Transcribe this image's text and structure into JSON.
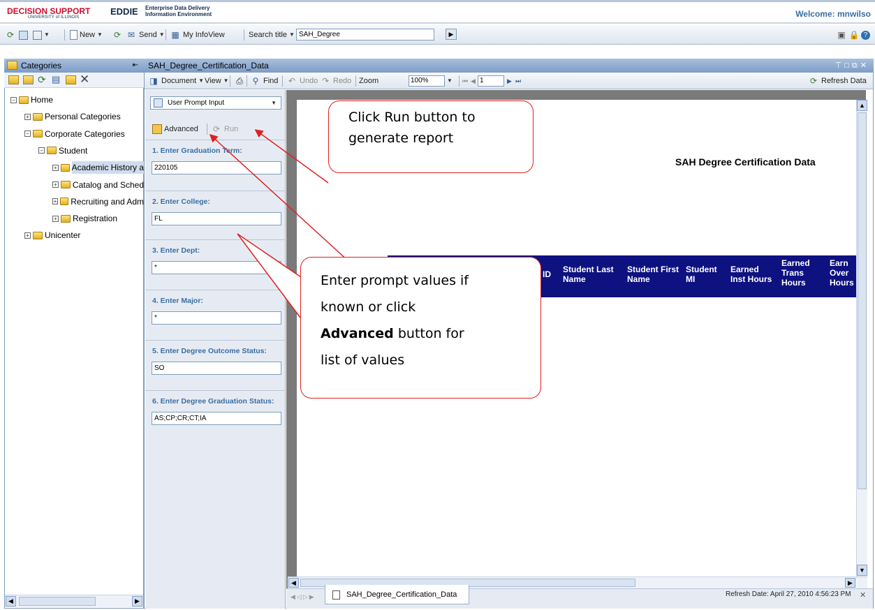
{
  "header": {
    "logo_ds": "DECISION SUPPORT",
    "logo_ds_sub": "UNIVERSITY of ILLINOIS",
    "logo_eddie": "EDDIE",
    "logo_eddie_line1": "Enterprise Data Delivery",
    "logo_eddie_line2": "Information Environment",
    "welcome": "Welcome: mnwilso"
  },
  "toolbar": {
    "new_label": "New",
    "send_label": "Send",
    "myinfoview_label": "My InfoView",
    "search_title_label": "Search title",
    "search_value": "SAH_Degree"
  },
  "left_panel": {
    "title": "Categories",
    "tree": [
      {
        "label": "Home",
        "level": 0,
        "expander": "−"
      },
      {
        "label": "Personal Categories",
        "level": 1,
        "expander": "+"
      },
      {
        "label": "Corporate Categories",
        "level": 1,
        "expander": "−"
      },
      {
        "label": "Student",
        "level": 2,
        "expander": "−"
      },
      {
        "label": "Academic History a",
        "level": 3,
        "expander": "+"
      },
      {
        "label": "Catalog and Sched",
        "level": 3,
        "expander": "+"
      },
      {
        "label": "Recruiting and Adm",
        "level": 3,
        "expander": "+"
      },
      {
        "label": "Registration",
        "level": 3,
        "expander": "+"
      },
      {
        "label": "Unicenter",
        "level": 1,
        "expander": "+"
      }
    ]
  },
  "document": {
    "title": "SAH_Degree_Certification_Data",
    "toolbar": {
      "document_label": "Document",
      "view_label": "View",
      "find_label": "Find",
      "undo_label": "Undo",
      "redo_label": "Redo",
      "zoom_label": "Zoom",
      "zoom_value": "100%",
      "page_value": "1",
      "refresh_label": "Refresh Data"
    }
  },
  "prompts": {
    "mode": "User Prompt Input",
    "advanced_label": "Advanced",
    "run_label": "Run",
    "items": [
      {
        "label": "1. Enter Graduation Term:",
        "value": "220105"
      },
      {
        "label": "2. Enter College:",
        "value": "FL"
      },
      {
        "label": "3. Enter Dept:",
        "value": "*"
      },
      {
        "label": "4. Enter Major:",
        "value": "*"
      },
      {
        "label": "5. Enter Degree Outcome Status:",
        "value": "SO"
      },
      {
        "label": "6. Enter Degree Graduation Status:",
        "value": "AS;CP;CR;CT;IA"
      }
    ]
  },
  "report": {
    "title": "SAH Degree Certification Data",
    "columns": [
      "ID",
      "Student Last Name",
      "Student First Name",
      "Student MI",
      "Earned Inst Hours",
      "Earned Trans Hours",
      "Earned Overall Hours"
    ],
    "column_fragments": {
      "id": "ID",
      "earned": "Earned",
      "earned_cut": "Earn",
      "trans": "Trans",
      "hours": "Hours",
      "hours_cut": "Hours",
      "overall_cut": "Over"
    }
  },
  "footer": {
    "tab_label": "SAH_Degree_Certification_Data",
    "refresh_date": "Refresh Date: April 27, 2010 4:56:23 PM"
  },
  "callouts": {
    "run": "Click Run button to generate report",
    "run_line1": "Click Run button to",
    "run_line2": "generate report",
    "prompt_line1": "Enter prompt values if",
    "prompt_line2": "known or click",
    "prompt_bold": "Advanced",
    "prompt_line3_rest": " button for",
    "prompt_line4": "list of values"
  },
  "colors": {
    "header_band": "#0e1180",
    "callout_border": "#e02020",
    "prompt_label": "#3a6ea5"
  }
}
